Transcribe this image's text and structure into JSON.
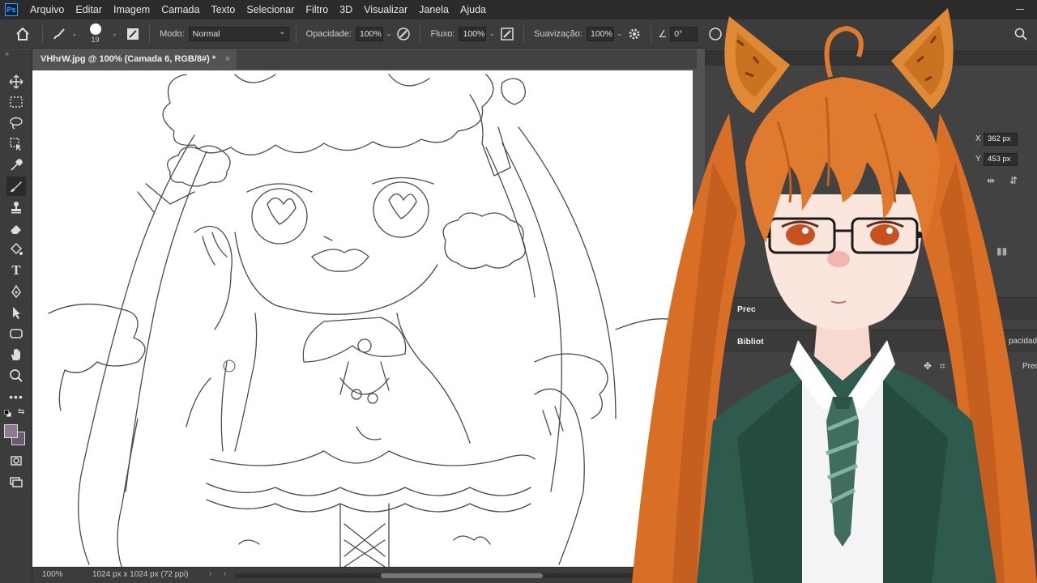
{
  "app": {
    "logo": "Ps"
  },
  "menu": [
    "Arquivo",
    "Editar",
    "Imagem",
    "Camada",
    "Texto",
    "Selecionar",
    "Filtro",
    "3D",
    "Visualizar",
    "Janela",
    "Ajuda"
  ],
  "options": {
    "brush_size": "19",
    "mode_label": "Modo:",
    "mode_value": "Normal",
    "opacity_label": "Opacidade:",
    "opacity_value": "100%",
    "flow_label": "Fluxo:",
    "flow_value": "100%",
    "smoothing_label": "Suavização:",
    "smoothing_value": "100%",
    "angle_value": "0°"
  },
  "document": {
    "tab_title": "VHhrW.jpg @ 100% (Camada 6, RGB/8#) *",
    "close_symbol": "×"
  },
  "status": {
    "zoom": "100%",
    "doc_info": "1024 px x 1024 px (72 ppi)",
    "arrow": "›",
    "scroll_left": "‹"
  },
  "panels": {
    "x_label": "X",
    "x_value": "362 px",
    "y_label": "Y",
    "y_value": "453 px",
    "properties_label": "Prec",
    "libraries_label": "Bibliot",
    "opacity_short": "pacidad",
    "preset_short": "Prec"
  },
  "colors": {
    "foreground": "#8c7b93",
    "background": "#6a5a74",
    "hair": "#e07a2e",
    "blazer": "#2f5a4e"
  },
  "icons": {
    "home": "home-icon",
    "brush": "brush-icon",
    "search": "search-icon",
    "settings": "gear-icon"
  }
}
